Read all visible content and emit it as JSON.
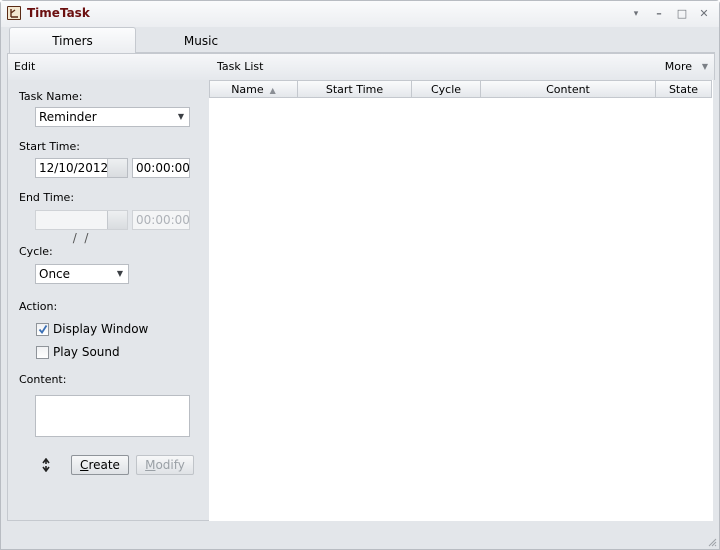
{
  "window": {
    "title": "TimeTask",
    "controls": {
      "menu": "▾",
      "minimize": "–",
      "maximize": "□",
      "close": "✕"
    }
  },
  "tabs": [
    {
      "label": "Timers",
      "active": true
    },
    {
      "label": "Music",
      "active": false
    }
  ],
  "edit_panel": {
    "header": "Edit",
    "task_name_label": "Task Name:",
    "task_name_value": "Reminder",
    "start_time_label": "Start Time:",
    "start_date_value": "12/10/2012",
    "start_time_value": "00:00:00",
    "end_time_label": "End Time:",
    "end_date_value": " /  /",
    "end_time_value": "00:00:00",
    "cycle_label": "Cycle:",
    "cycle_value": "Once",
    "action_label": "Action:",
    "actions": [
      {
        "label": "Display Window",
        "checked": true
      },
      {
        "label": "Play Sound",
        "checked": false
      }
    ],
    "content_label": "Content:",
    "content_value": "",
    "create_button": {
      "prefix": "",
      "accel": "C",
      "rest": "reate"
    },
    "modify_button": {
      "prefix": "",
      "accel": "M",
      "rest": "odify"
    }
  },
  "task_list": {
    "header": "Task List",
    "more_label": "More",
    "columns": [
      "Name",
      "Start Time",
      "Cycle",
      "Content",
      "State"
    ],
    "sorted_column": "Name",
    "sort_direction": "ascending",
    "rows": []
  },
  "icons": {
    "dropdown": "▼",
    "sort_up": "▲"
  }
}
